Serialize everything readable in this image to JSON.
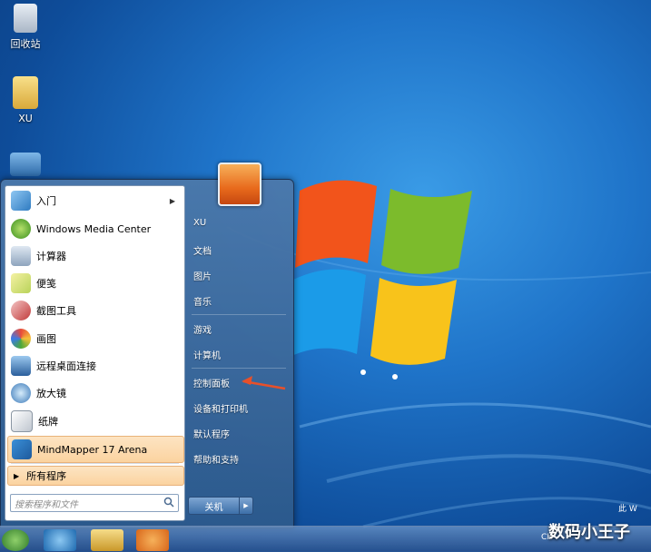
{
  "desktop": {
    "icons": [
      {
        "label": "回收站",
        "name": "recycle-bin"
      },
      {
        "label": "XU",
        "name": "user-folder"
      },
      {
        "label": "",
        "name": "computer"
      }
    ]
  },
  "start_menu": {
    "programs": [
      {
        "label": "入门",
        "icon": "getting-started-icon",
        "has_submenu": true
      },
      {
        "label": "Windows Media Center",
        "icon": "media-center-icon"
      },
      {
        "label": "计算器",
        "icon": "calculator-icon"
      },
      {
        "label": "便笺",
        "icon": "sticky-notes-icon"
      },
      {
        "label": "截图工具",
        "icon": "snipping-tool-icon"
      },
      {
        "label": "画图",
        "icon": "paint-icon"
      },
      {
        "label": "远程桌面连接",
        "icon": "remote-desktop-icon"
      },
      {
        "label": "放大镜",
        "icon": "magnifier-icon"
      },
      {
        "label": "纸牌",
        "icon": "solitaire-icon"
      },
      {
        "label": "MindMapper 17 Arena",
        "icon": "mindmapper-icon"
      }
    ],
    "all_programs": "所有程序",
    "search_placeholder": "搜索程序和文件",
    "right_items": [
      {
        "label": "XU"
      },
      {
        "label": "文档"
      },
      {
        "label": "图片"
      },
      {
        "label": "音乐"
      },
      {
        "label": "游戏"
      },
      {
        "label": "计算机"
      },
      {
        "label": "控制面板"
      },
      {
        "label": "设备和打印机"
      },
      {
        "label": "默认程序"
      },
      {
        "label": "帮助和支持"
      }
    ],
    "shutdown_label": "关机"
  },
  "taskbar": {
    "tray_text_left": "CH",
    "tray_text_right": "此 W"
  },
  "watermark": "数码小王子",
  "colors": {
    "accent_arrow": "#e8502a",
    "highlight": "#fbd3a0"
  }
}
